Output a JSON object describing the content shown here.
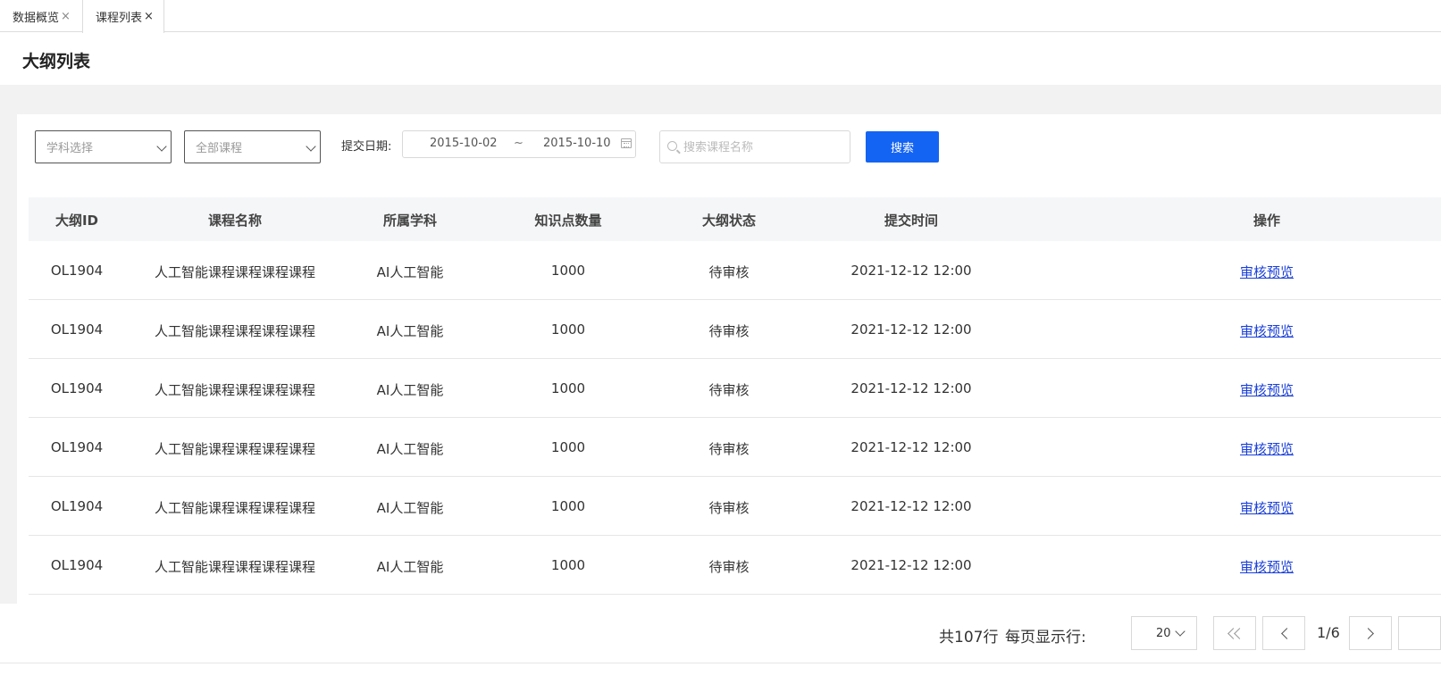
{
  "tabs": [
    {
      "label": "数据概览",
      "close": "×"
    },
    {
      "label": "课程列表",
      "close": "×"
    }
  ],
  "page_title": "大纲列表",
  "filters": {
    "subject_select": "学科选择",
    "course_select": "全部课程",
    "date_label": "提交日期:",
    "date_start": "2015-10-02",
    "date_separator": "~",
    "date_end": "2015-10-10",
    "search_placeholder": "搜索课程名称",
    "search_button": "搜索"
  },
  "table": {
    "headers": [
      "大纲ID",
      "课程名称",
      "所属学科",
      "知识点数量",
      "大纲状态",
      "提交时间",
      "操作"
    ],
    "rows": [
      {
        "id": "OL1904",
        "course": "人工智能课程课程课程课程",
        "subject": "AI人工智能",
        "points": "1000",
        "status": "待审核",
        "time": "2021-12-12  12:00",
        "action": "审核预览"
      },
      {
        "id": "OL1904",
        "course": "人工智能课程课程课程课程",
        "subject": "AI人工智能",
        "points": "1000",
        "status": "待审核",
        "time": "2021-12-12  12:00",
        "action": "审核预览"
      },
      {
        "id": "OL1904",
        "course": "人工智能课程课程课程课程",
        "subject": "AI人工智能",
        "points": "1000",
        "status": "待审核",
        "time": "2021-12-12  12:00",
        "action": "审核预览"
      },
      {
        "id": "OL1904",
        "course": "人工智能课程课程课程课程",
        "subject": "AI人工智能",
        "points": "1000",
        "status": "待审核",
        "time": "2021-12-12  12:00",
        "action": "审核预览"
      },
      {
        "id": "OL1904",
        "course": "人工智能课程课程课程课程",
        "subject": "AI人工智能",
        "points": "1000",
        "status": "待审核",
        "time": "2021-12-12  12:00",
        "action": "审核预览"
      },
      {
        "id": "OL1904",
        "course": "人工智能课程课程课程课程",
        "subject": "AI人工智能",
        "points": "1000",
        "status": "待审核",
        "time": "2021-12-12  12:00",
        "action": "审核预览"
      }
    ]
  },
  "pagination": {
    "total": "共107行",
    "per_page_label": "每页显示行:",
    "page_size": "20",
    "page_indicator": "1/6"
  },
  "colors": {
    "primary_button": "#1464f4",
    "link": "#1a3fd8",
    "header_bg": "#f5f6f8",
    "page_bg": "#f2f2f2"
  },
  "icons": [
    "close-icon",
    "chevron-down-icon",
    "calendar-icon",
    "search-icon",
    "double-chevron-left-icon",
    "chevron-left-icon",
    "chevron-right-icon"
  ]
}
